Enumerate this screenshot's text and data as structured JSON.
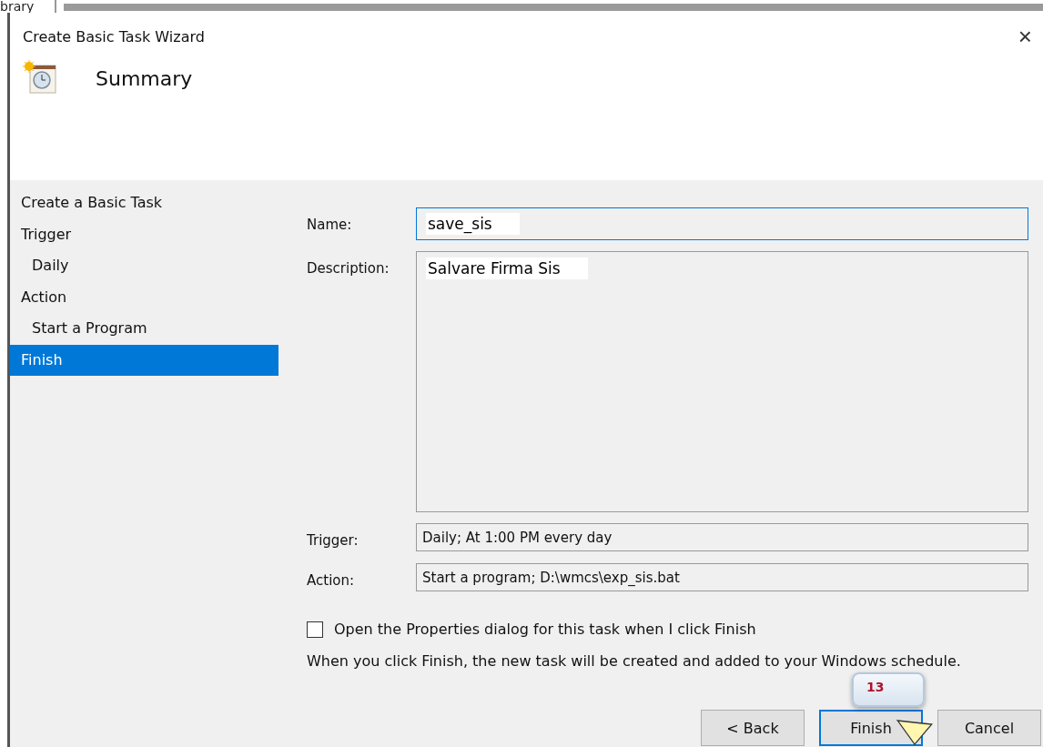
{
  "background": {
    "label": "brary"
  },
  "window": {
    "title": "Create Basic Task Wizard",
    "close": "×"
  },
  "header": {
    "title": "Summary"
  },
  "steps": [
    {
      "label": "Create a Basic Task",
      "sub": false,
      "selected": false
    },
    {
      "label": "Trigger",
      "sub": false,
      "selected": false
    },
    {
      "label": "Daily",
      "sub": true,
      "selected": false
    },
    {
      "label": "Action",
      "sub": false,
      "selected": false
    },
    {
      "label": "Start a Program",
      "sub": true,
      "selected": false
    },
    {
      "label": "Finish",
      "sub": false,
      "selected": true
    }
  ],
  "form": {
    "name": {
      "label": "Name:",
      "value": "save_sis"
    },
    "description": {
      "label": "Description:",
      "value": "Salvare Firma Sis"
    },
    "trigger": {
      "label": "Trigger:",
      "value": "Daily; At 1:00 PM every day"
    },
    "action": {
      "label": "Action:",
      "value": "Start a program; D:\\wmcs\\exp_sis.bat"
    }
  },
  "open_properties": {
    "label": "Open the Properties dialog for this task when I click Finish",
    "checked": false
  },
  "info": "When you click Finish, the new task will be created and added to your Windows schedule.",
  "buttons": [
    {
      "label": "< Back",
      "focused": false
    },
    {
      "label": "Finish",
      "focused": true
    },
    {
      "label": "Cancel",
      "focused": false
    }
  ],
  "callout": {
    "number": "13"
  }
}
